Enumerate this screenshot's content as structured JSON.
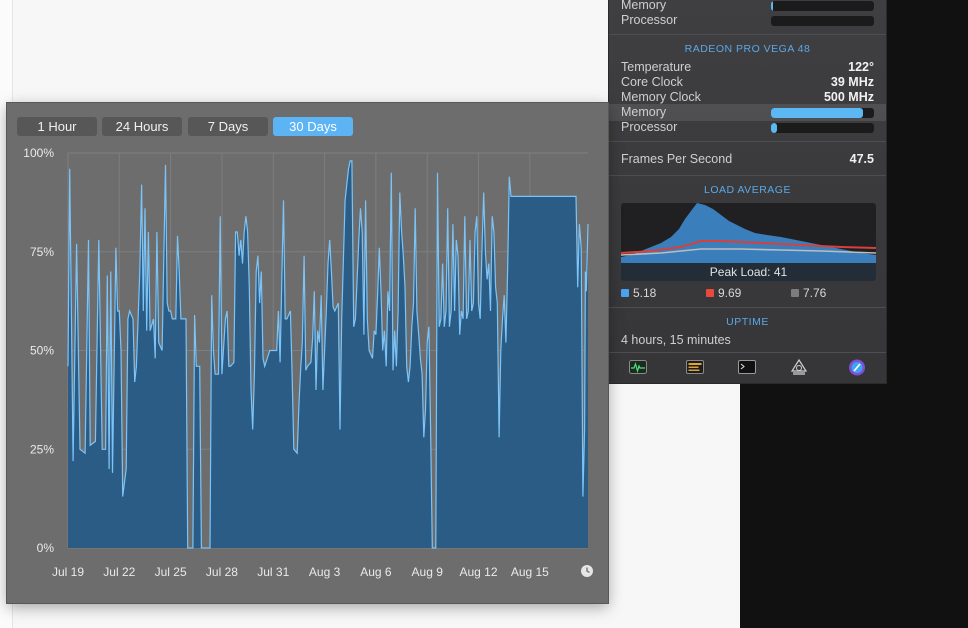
{
  "menu": {
    "cpu_rows": [
      {
        "label": "Memory"
      },
      {
        "label": "Processor"
      }
    ],
    "gpu_title": "RADEON PRO VEGA 48",
    "gpu_stats": [
      {
        "label": "Temperature",
        "value": "122°"
      },
      {
        "label": "Core Clock",
        "value": "39 MHz"
      },
      {
        "label": "Memory Clock",
        "value": "500 MHz"
      }
    ],
    "gpu_memory_label": "Memory",
    "gpu_memory_fraction": 0.89,
    "gpu_processor_label": "Processor",
    "gpu_processor_fraction": 0.06,
    "fps_label": "Frames Per Second",
    "fps_value": "47.5",
    "load_title": "LOAD AVERAGE",
    "peak_load": "Peak Load: 41",
    "load_legend": [
      {
        "value": "5.18",
        "color": "#4aa3f0"
      },
      {
        "value": "9.69",
        "color": "#e8493d"
      },
      {
        "value": "7.76",
        "color": "#7c7c7c"
      }
    ],
    "uptime_title": "UPTIME",
    "uptime_value": "4 hours, 15 minutes",
    "toolbar_icons": [
      "activity-monitor-icon",
      "console-icon",
      "terminal-icon",
      "disk-utility-icon",
      "system-preferences-icon"
    ]
  },
  "chart_window": {
    "ranges": [
      "1 Hour",
      "24 Hours",
      "7 Days",
      "30 Days"
    ],
    "selected_range": "30 Days"
  },
  "chart_data": {
    "type": "area",
    "title": "",
    "xlabel": "",
    "ylabel": "",
    "ylim": [
      0,
      100
    ],
    "yticks": [
      "100%",
      "75%",
      "50%",
      "25%",
      "0%"
    ],
    "xticks": [
      "Jul 19",
      "Jul 22",
      "Jul 25",
      "Jul 28",
      "Jul 31",
      "Aug 3",
      "Aug 6",
      "Aug 9",
      "Aug 12",
      "Aug 15"
    ],
    "grid": true,
    "color": "#2a5c85",
    "line_color": "#7cc4f7",
    "x_start_day": 0,
    "x_end_day": 30.4,
    "series": [
      {
        "points": [
          [
            0.0,
            46
          ],
          [
            0.1,
            96
          ],
          [
            0.3,
            22
          ],
          [
            0.5,
            77
          ],
          [
            0.7,
            25
          ],
          [
            1.0,
            24
          ],
          [
            1.2,
            78
          ],
          [
            1.3,
            26
          ],
          [
            1.6,
            27
          ],
          [
            1.8,
            78
          ],
          [
            2.0,
            25
          ],
          [
            2.2,
            25
          ],
          [
            2.3,
            69
          ],
          [
            2.4,
            20
          ],
          [
            2.5,
            70
          ],
          [
            2.6,
            19
          ],
          [
            2.8,
            76
          ],
          [
            2.9,
            60
          ],
          [
            3.0,
            60
          ],
          [
            3.1,
            50
          ],
          [
            3.2,
            13
          ],
          [
            3.4,
            20
          ],
          [
            3.5,
            58
          ],
          [
            3.6,
            60
          ],
          [
            3.8,
            58
          ],
          [
            3.9,
            42
          ],
          [
            4.0,
            46
          ],
          [
            4.2,
            70
          ],
          [
            4.3,
            92
          ],
          [
            4.4,
            60
          ],
          [
            4.5,
            86
          ],
          [
            4.6,
            55
          ],
          [
            4.7,
            80
          ],
          [
            4.8,
            55
          ],
          [
            5.0,
            58
          ],
          [
            5.1,
            48
          ],
          [
            5.2,
            80
          ],
          [
            5.3,
            52
          ],
          [
            5.5,
            50
          ],
          [
            5.7,
            97
          ],
          [
            5.8,
            62
          ],
          [
            5.9,
            60
          ],
          [
            6.0,
            60
          ],
          [
            6.1,
            58
          ],
          [
            6.3,
            58
          ],
          [
            6.4,
            79
          ],
          [
            6.5,
            70
          ],
          [
            6.6,
            58
          ],
          [
            6.9,
            58
          ],
          [
            7.0,
            0
          ],
          [
            7.3,
            0
          ],
          [
            7.4,
            59
          ],
          [
            7.5,
            46
          ],
          [
            7.6,
            46
          ],
          [
            7.7,
            46
          ],
          [
            7.8,
            0
          ],
          [
            8.3,
            0
          ],
          [
            8.4,
            64
          ],
          [
            8.5,
            50
          ],
          [
            8.6,
            44
          ],
          [
            8.8,
            44
          ],
          [
            8.9,
            84
          ],
          [
            9.0,
            44
          ],
          [
            9.2,
            58
          ],
          [
            9.3,
            60
          ],
          [
            9.4,
            46
          ],
          [
            9.5,
            46
          ],
          [
            9.7,
            47
          ],
          [
            9.8,
            80
          ],
          [
            9.9,
            80
          ],
          [
            10.0,
            74
          ],
          [
            10.1,
            78
          ],
          [
            10.2,
            72
          ],
          [
            10.3,
            80
          ],
          [
            10.4,
            84
          ],
          [
            10.5,
            80
          ],
          [
            10.6,
            66
          ],
          [
            10.7,
            40
          ],
          [
            10.8,
            30
          ],
          [
            10.9,
            44
          ],
          [
            11.0,
            70
          ],
          [
            11.1,
            74
          ],
          [
            11.2,
            62
          ],
          [
            11.3,
            70
          ],
          [
            11.4,
            48
          ],
          [
            11.5,
            46
          ],
          [
            11.8,
            50
          ],
          [
            12.0,
            50
          ],
          [
            12.2,
            50
          ],
          [
            12.3,
            60
          ],
          [
            12.4,
            47
          ],
          [
            12.5,
            68
          ],
          [
            12.6,
            88
          ],
          [
            12.7,
            58
          ],
          [
            12.8,
            58
          ],
          [
            13.0,
            60
          ],
          [
            13.1,
            44
          ],
          [
            13.2,
            25
          ],
          [
            13.4,
            24
          ],
          [
            13.5,
            36
          ],
          [
            13.6,
            45
          ],
          [
            13.7,
            52
          ],
          [
            13.8,
            74
          ],
          [
            13.9,
            45
          ],
          [
            14.0,
            46
          ],
          [
            14.2,
            47
          ],
          [
            14.3,
            53
          ],
          [
            14.4,
            65
          ],
          [
            14.5,
            40
          ],
          [
            14.6,
            55
          ],
          [
            14.7,
            52
          ],
          [
            14.8,
            64
          ],
          [
            14.9,
            40
          ],
          [
            15.0,
            50
          ],
          [
            15.1,
            60
          ],
          [
            15.2,
            72
          ],
          [
            15.3,
            78
          ],
          [
            15.4,
            70
          ],
          [
            15.5,
            61
          ],
          [
            15.6,
            60
          ],
          [
            15.8,
            62
          ],
          [
            15.9,
            30
          ],
          [
            16.0,
            58
          ],
          [
            16.2,
            88
          ],
          [
            16.3,
            92
          ],
          [
            16.4,
            96
          ],
          [
            16.5,
            98
          ],
          [
            16.6,
            98
          ],
          [
            16.7,
            56
          ],
          [
            16.8,
            58
          ],
          [
            17.0,
            78
          ],
          [
            17.1,
            86
          ],
          [
            17.2,
            80
          ],
          [
            17.3,
            54
          ],
          [
            17.4,
            88
          ],
          [
            17.5,
            58
          ],
          [
            17.6,
            50
          ],
          [
            17.8,
            48
          ],
          [
            17.9,
            55
          ],
          [
            18.0,
            54
          ],
          [
            18.1,
            64
          ],
          [
            18.2,
            76
          ],
          [
            18.3,
            65
          ],
          [
            18.4,
            50
          ],
          [
            18.5,
            55
          ],
          [
            18.6,
            46
          ],
          [
            18.7,
            65
          ],
          [
            18.8,
            60
          ],
          [
            18.9,
            95
          ],
          [
            19.0,
            45
          ],
          [
            19.1,
            55
          ],
          [
            19.2,
            46
          ],
          [
            19.3,
            60
          ],
          [
            19.4,
            90
          ],
          [
            19.5,
            80
          ],
          [
            19.6,
            74
          ],
          [
            19.7,
            66
          ],
          [
            19.8,
            46
          ],
          [
            19.9,
            42
          ],
          [
            20.0,
            46
          ],
          [
            20.1,
            56
          ],
          [
            20.2,
            62
          ],
          [
            20.3,
            86
          ],
          [
            20.4,
            60
          ],
          [
            20.5,
            54
          ],
          [
            20.6,
            48
          ],
          [
            20.7,
            44
          ],
          [
            20.8,
            28
          ],
          [
            20.9,
            35
          ],
          [
            21.0,
            52
          ],
          [
            21.1,
            56
          ],
          [
            21.2,
            30
          ],
          [
            21.3,
            0
          ],
          [
            21.5,
            0
          ],
          [
            21.6,
            95
          ],
          [
            21.7,
            56
          ],
          [
            21.8,
            58
          ],
          [
            21.9,
            72
          ],
          [
            22.0,
            56
          ],
          [
            22.1,
            60
          ],
          [
            22.2,
            86
          ],
          [
            22.3,
            56
          ],
          [
            22.4,
            60
          ],
          [
            22.5,
            82
          ],
          [
            22.6,
            60
          ],
          [
            22.7,
            78
          ],
          [
            22.8,
            74
          ],
          [
            22.9,
            54
          ],
          [
            23.0,
            60
          ],
          [
            23.1,
            58
          ],
          [
            23.2,
            84
          ],
          [
            23.3,
            58
          ],
          [
            23.4,
            60
          ],
          [
            23.5,
            78
          ],
          [
            23.6,
            60
          ],
          [
            23.7,
            62
          ],
          [
            23.8,
            80
          ],
          [
            23.9,
            84
          ],
          [
            24.0,
            62
          ],
          [
            24.1,
            58
          ],
          [
            24.2,
            75
          ],
          [
            24.3,
            90
          ],
          [
            24.4,
            75
          ],
          [
            24.5,
            68
          ],
          [
            24.6,
            72
          ],
          [
            24.7,
            60
          ],
          [
            24.8,
            84
          ],
          [
            24.9,
            80
          ],
          [
            25.0,
            66
          ],
          [
            25.1,
            62
          ],
          [
            25.2,
            28
          ],
          [
            25.3,
            50
          ],
          [
            25.4,
            58
          ],
          [
            25.5,
            64
          ],
          [
            25.6,
            52
          ],
          [
            25.7,
            70
          ],
          [
            25.8,
            94
          ],
          [
            25.9,
            76
          ],
          [
            26.0,
            54
          ],
          [
            26.1,
            48
          ],
          [
            26.2,
            36
          ],
          [
            26.3,
            64
          ],
          [
            26.4,
            50
          ],
          [
            26.5,
            56
          ],
          [
            26.6,
            84
          ],
          [
            26.7,
            80
          ],
          [
            26.8,
            88
          ],
          [
            26.9,
            64
          ],
          [
            27.0,
            56
          ],
          [
            27.1,
            46
          ],
          [
            27.2,
            60
          ],
          [
            27.3,
            58
          ],
          [
            27.4,
            62
          ],
          [
            27.5,
            70
          ],
          [
            27.6,
            88
          ],
          [
            27.7,
            70
          ],
          [
            27.8,
            62
          ],
          [
            27.9,
            58
          ],
          [
            28.0,
            58
          ],
          [
            28.1,
            64
          ],
          [
            28.2,
            60
          ],
          [
            28.3,
            72
          ],
          [
            28.4,
            84
          ],
          [
            28.5,
            76
          ],
          [
            28.6,
            58
          ],
          [
            28.7,
            56
          ],
          [
            28.8,
            60
          ],
          [
            28.9,
            68
          ],
          [
            29.0,
            76
          ],
          [
            29.1,
            78
          ],
          [
            29.2,
            74
          ],
          [
            29.3,
            70
          ],
          [
            29.4,
            64
          ],
          [
            29.5,
            58
          ],
          [
            29.6,
            54
          ],
          [
            29.7,
            56
          ],
          [
            29.8,
            66
          ],
          [
            29.9,
            82
          ],
          [
            30.0,
            76
          ],
          [
            30.1,
            13
          ],
          [
            30.2,
            30
          ],
          [
            30.25,
            70
          ],
          [
            30.3,
            65
          ],
          [
            30.4,
            82
          ]
        ],
        "plateaus": [
          {
            "from": 25.9,
            "to": 29.7,
            "value": 89
          }
        ]
      }
    ]
  }
}
